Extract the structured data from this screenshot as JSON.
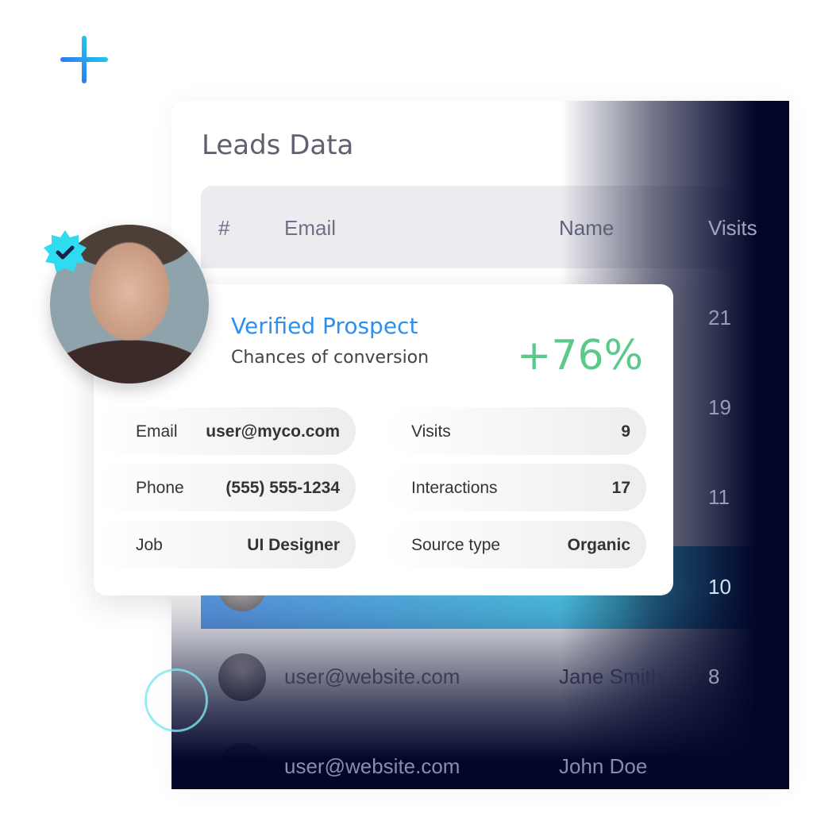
{
  "panel": {
    "title": "Leads Data",
    "columns": [
      "#",
      "Email",
      "Name",
      "Visits"
    ],
    "rows": [
      {
        "visits": "21"
      },
      {
        "visits": "19"
      },
      {
        "visits": "11"
      },
      {
        "email": "",
        "visits": "10",
        "highlighted": true
      },
      {
        "email": "user@website.com",
        "name": "Jane Smith",
        "visits": "8"
      },
      {
        "email": "user@website.com",
        "name": "John Doe",
        "visits": ""
      }
    ]
  },
  "card": {
    "title": "Verified Prospect",
    "subtitle": "Chances of conversion",
    "percent": "+76%",
    "fields": [
      {
        "label": "Email",
        "value": "user@myco.com"
      },
      {
        "label": "Visits",
        "value": "9"
      },
      {
        "label": "Phone",
        "value": "(555) 555-1234"
      },
      {
        "label": "Interactions",
        "value": "17"
      },
      {
        "label": "Job",
        "value": "UI Designer"
      },
      {
        "label": "Source type",
        "value": "Organic"
      }
    ]
  },
  "colors": {
    "accent": "#2d8ff0",
    "success": "#5cc98a",
    "dark": "#02062a",
    "badge": "#2fdcef"
  }
}
